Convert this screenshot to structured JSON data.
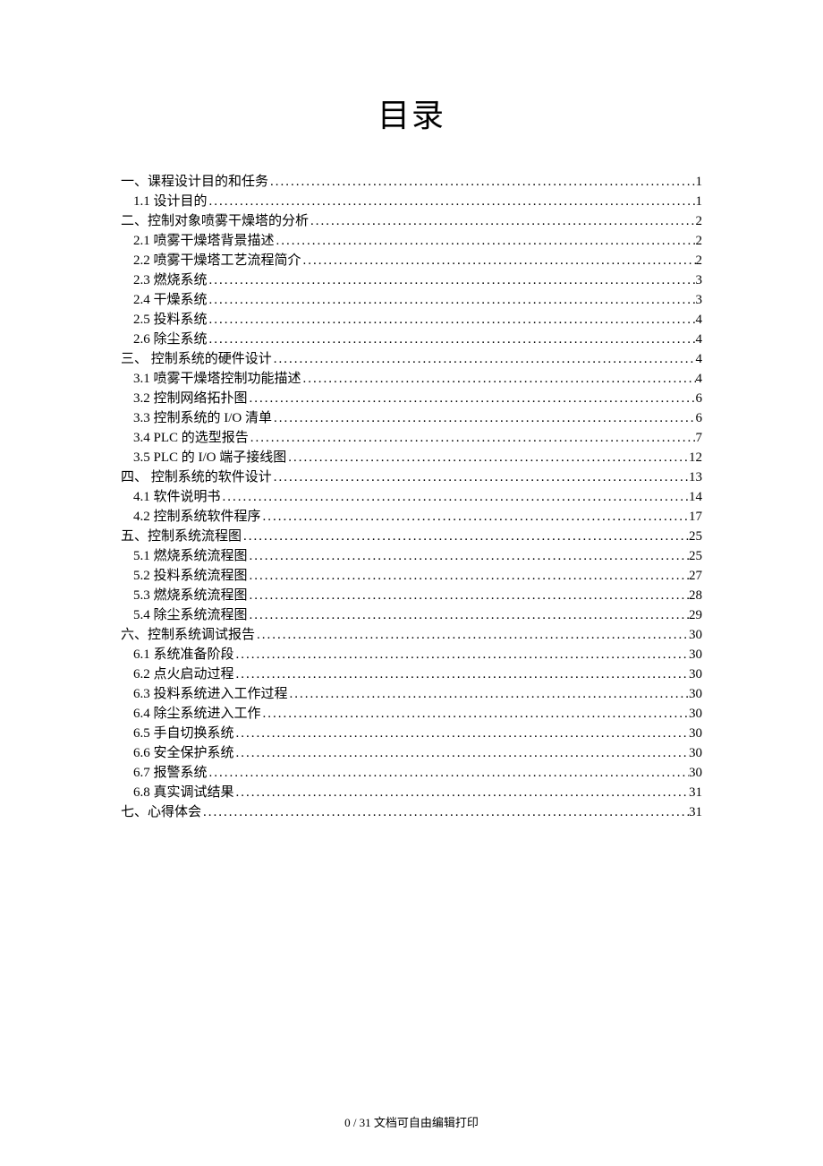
{
  "title": "目录",
  "toc": [
    {
      "level": 1,
      "label": "一、课程设计目的和任务",
      "page": "1"
    },
    {
      "level": 2,
      "label": "1.1 设计目的",
      "page": "1"
    },
    {
      "level": 1,
      "label": "二、控制对象喷雾干燥塔的分析",
      "page": "2"
    },
    {
      "level": 2,
      "label": "2.1 喷雾干燥塔背景描述",
      "page": "2"
    },
    {
      "level": 2,
      "label": "2.2 喷雾干燥塔工艺流程简介",
      "page": "2"
    },
    {
      "level": 2,
      "label": "2.3 燃烧系统",
      "page": "3"
    },
    {
      "level": 2,
      "label": "2.4 干燥系统",
      "page": "3"
    },
    {
      "level": 2,
      "label": "2.5 投料系统",
      "page": "4"
    },
    {
      "level": 2,
      "label": "2.6 除尘系统",
      "page": "4"
    },
    {
      "level": 1,
      "label": "三、 控制系统的硬件设计",
      "page": "4"
    },
    {
      "level": 2,
      "label": "3.1 喷雾干燥塔控制功能描述",
      "page": "4"
    },
    {
      "level": 2,
      "label": "3.2 控制网络拓扑图",
      "page": "6"
    },
    {
      "level": 2,
      "label": "3.3 控制系统的 I/O 清单",
      "page": "6"
    },
    {
      "level": 2,
      "label": "3.4 PLC 的选型报告",
      "page": "7"
    },
    {
      "level": 2,
      "label": "3.5 PLC 的 I/O 端子接线图",
      "page": "12"
    },
    {
      "level": 1,
      "label": "四、 控制系统的软件设计",
      "page": "13"
    },
    {
      "level": 2,
      "label": "4.1 软件说明书",
      "page": "14"
    },
    {
      "level": 2,
      "label": "4.2 控制系统软件程序",
      "page": "17"
    },
    {
      "level": 1,
      "label": "五、控制系统流程图",
      "page": "25"
    },
    {
      "level": 2,
      "label": "5.1 燃烧系统流程图",
      "page": "25"
    },
    {
      "level": 2,
      "label": "5.2 投料系统流程图",
      "page": "27"
    },
    {
      "level": 2,
      "label": "5.3 燃烧系统流程图",
      "page": "28"
    },
    {
      "level": 2,
      "label": "5.4 除尘系统流程图",
      "page": "29"
    },
    {
      "level": 1,
      "label": "六、控制系统调试报告",
      "page": "30"
    },
    {
      "level": 2,
      "label": "6.1 系统准备阶段",
      "page": "30"
    },
    {
      "level": 2,
      "label": "6.2 点火启动过程",
      "page": "30"
    },
    {
      "level": 2,
      "label": "6.3 投料系统进入工作过程",
      "page": "30"
    },
    {
      "level": 2,
      "label": "6.4 除尘系统进入工作",
      "page": "30"
    },
    {
      "level": 2,
      "label": "6.5 手自切换系统",
      "page": "30"
    },
    {
      "level": 2,
      "label": "6.6 安全保护系统",
      "page": "30"
    },
    {
      "level": 2,
      "label": "6.7 报警系统",
      "page": "30"
    },
    {
      "level": 2,
      "label": "6.8 真实调试结果",
      "page": "31"
    },
    {
      "level": 1,
      "label": "七、心得体会",
      "page": "31"
    }
  ],
  "footer": "0 / 31 文档可自由编辑打印"
}
